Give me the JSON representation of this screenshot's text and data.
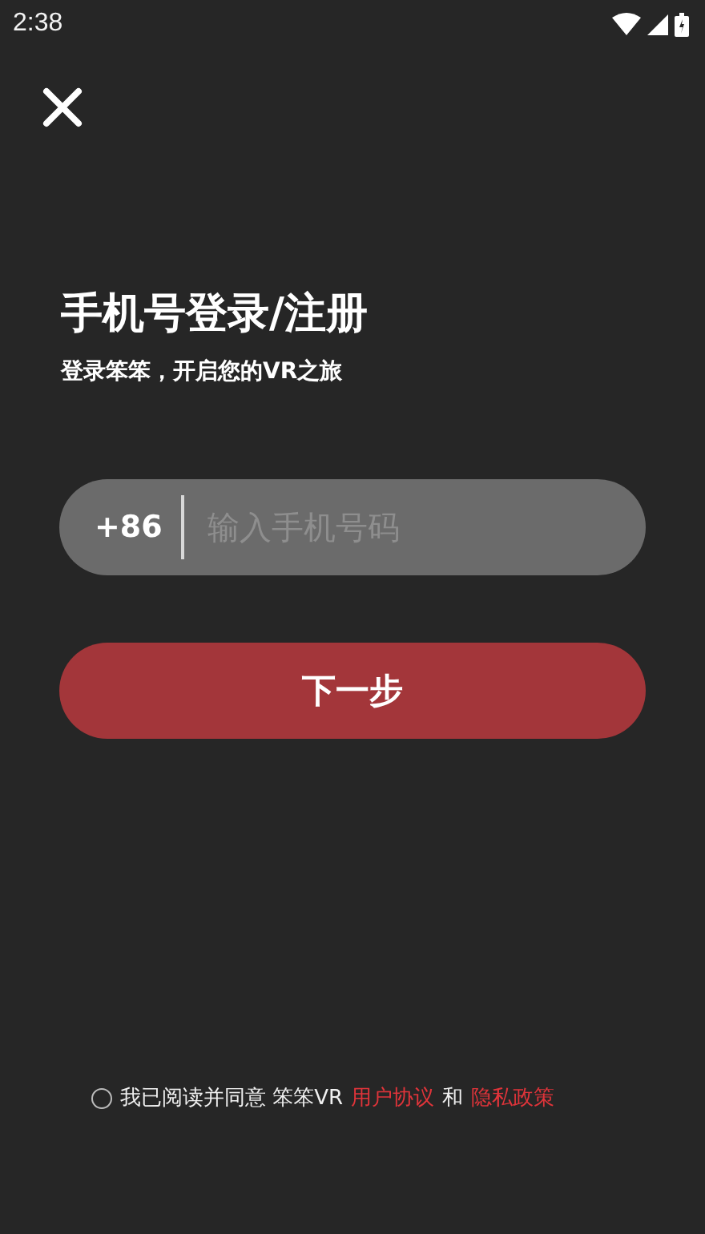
{
  "status_bar": {
    "time": "2:38"
  },
  "title": "手机号登录/注册",
  "subtitle": "登录笨笨，开启您的VR之旅",
  "phone_field": {
    "country_code": "+86",
    "placeholder": "输入手机号码"
  },
  "next_button": "下一步",
  "agreement": {
    "checked": false,
    "text": "我已阅读并同意 笨笨VR",
    "links": [
      "用户协议",
      "隐私政策"
    ],
    "joiner": "和"
  }
}
